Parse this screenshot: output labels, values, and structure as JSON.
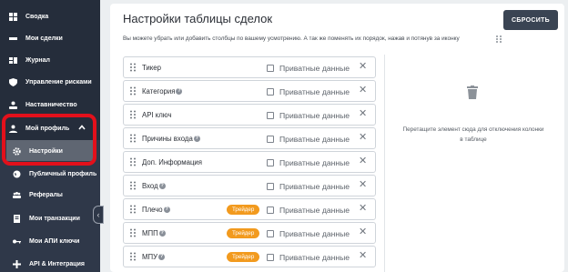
{
  "sidebar": {
    "items": [
      {
        "label": "Сводка",
        "icon": "dashboard-icon"
      },
      {
        "label": "Мои сделки",
        "icon": "trades-icon"
      },
      {
        "label": "Журнал",
        "icon": "journal-icon"
      },
      {
        "label": "Управление рисками",
        "icon": "shield-icon"
      },
      {
        "label": "Наставничество",
        "icon": "mentor-icon"
      },
      {
        "label": "Мой профиль",
        "icon": "user-icon"
      },
      {
        "label": "Настройки",
        "icon": "gear-icon"
      },
      {
        "label": "Публичный профиль",
        "icon": "globe-icon"
      },
      {
        "label": "Рефералы",
        "icon": "group-icon"
      },
      {
        "label": "Мои транзакции",
        "icon": "receipt-icon"
      },
      {
        "label": "Мои АПИ ключи",
        "icon": "key-icon"
      },
      {
        "label": "API & Интеграция",
        "icon": "integration-icon"
      }
    ]
  },
  "main": {
    "title": "Настройки таблицы сделок",
    "reset_label": "СБРОСИТЬ",
    "description": "Вы можете убрать или добавить столбцы по вашему усмотрению. А так же поменять их порядок, нажав и потянув за иконку",
    "columns": [
      {
        "name": "Тикер",
        "help": false,
        "badge": ""
      },
      {
        "name": "Категория",
        "help": true,
        "badge": ""
      },
      {
        "name": "API ключ",
        "help": false,
        "badge": ""
      },
      {
        "name": "Причины входа",
        "help": true,
        "badge": ""
      },
      {
        "name": "Доп. Информация",
        "help": false,
        "badge": ""
      },
      {
        "name": "Вход",
        "help": true,
        "badge": ""
      },
      {
        "name": "Плечо",
        "help": true,
        "badge": "Трейдер"
      },
      {
        "name": "МПП",
        "help": true,
        "badge": "Трейдер"
      },
      {
        "name": "МПУ",
        "help": true,
        "badge": "Трейдер"
      }
    ],
    "private_label": "Приватные данные",
    "drop_zone_text": "Перетащите элемент сюда для отключения колонки в таблице"
  },
  "colors": {
    "sidebar_bg": "#252d3b",
    "highlight": "#e3101b",
    "badge": "#f29a1e",
    "button": "#3a4453"
  }
}
